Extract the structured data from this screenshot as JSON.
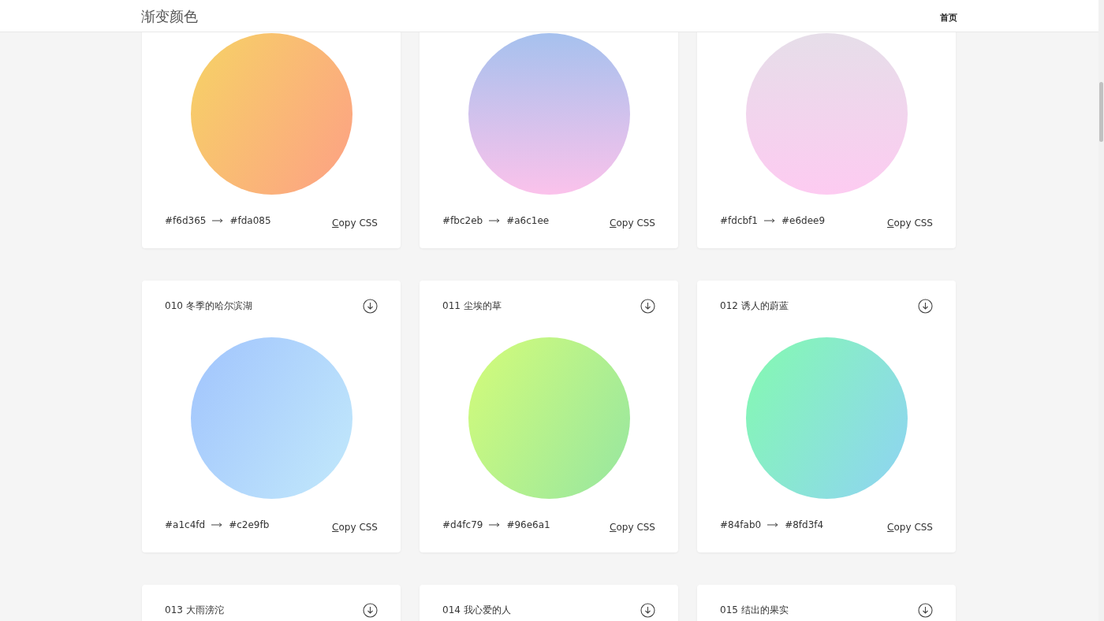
{
  "header": {
    "title": "渐变颜色",
    "nav": [
      {
        "label": "首页"
      }
    ]
  },
  "cards": [
    {
      "kind": "diagonal",
      "from": "#f6d365",
      "to": "#fda085",
      "copy": "Copy CSS"
    },
    {
      "kind": "vertical",
      "from": "#fbc2eb",
      "to": "#a6c1ee",
      "copy": "Copy CSS"
    },
    {
      "kind": "vertical",
      "from": "#fdcbf1",
      "to": "#e6dee9",
      "copy": "Copy CSS"
    },
    {
      "kind": "diagonal",
      "name": "010 冬季的哈尔滨湖",
      "from": "#a1c4fd",
      "to": "#c2e9fb",
      "copy": "Copy CSS"
    },
    {
      "kind": "diagonal",
      "name": "011 尘埃的草",
      "from": "#d4fc79",
      "to": "#96e6a1",
      "copy": "Copy CSS"
    },
    {
      "kind": "diagonal",
      "name": "012 诱人的蔚蓝",
      "from": "#84fab0",
      "to": "#8fd3f4",
      "copy": "Copy CSS"
    },
    {
      "kind": "cut",
      "name": "013 大雨滂沱"
    },
    {
      "kind": "cut",
      "name": "014 我心爱的人"
    },
    {
      "kind": "cut",
      "name": "015 结出的果实"
    }
  ]
}
